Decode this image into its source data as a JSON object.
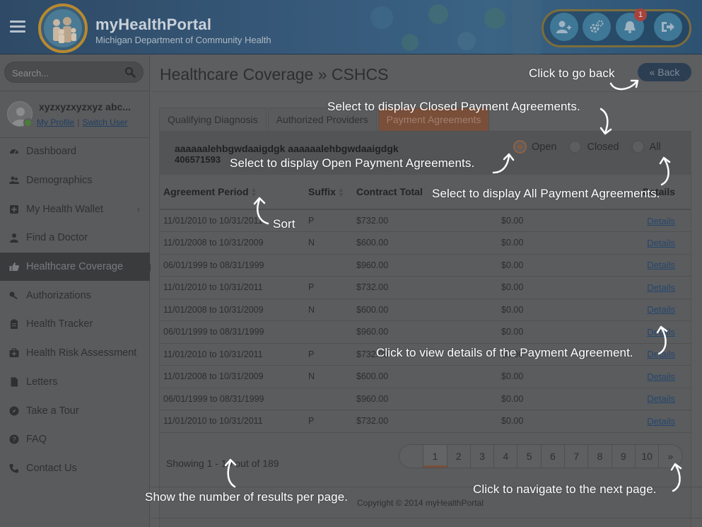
{
  "header": {
    "app_name": "myHealthPortal",
    "app_subtitle": "Michigan Department of Community Health",
    "notification_count": "1"
  },
  "sidebar": {
    "search_placeholder": "Search...",
    "user_name": "xyzxyzxyzxyz abc...",
    "my_profile": "My Profile",
    "switch_user": "Switch User",
    "items": [
      {
        "label": "Dashboard",
        "icon": "dashboard-icon"
      },
      {
        "label": "Demographics",
        "icon": "users-icon"
      },
      {
        "label": "My Health Wallet",
        "icon": "plus-square-icon"
      },
      {
        "label": "Find a Doctor",
        "icon": "user-md-icon"
      },
      {
        "label": "Healthcare Coverage",
        "icon": "thumbs-up-icon"
      },
      {
        "label": "Authorizations",
        "icon": "key-icon"
      },
      {
        "label": "Health Tracker",
        "icon": "clipboard-icon"
      },
      {
        "label": "Health Risk Assessment",
        "icon": "medkit-icon"
      },
      {
        "label": "Letters",
        "icon": "file-icon"
      },
      {
        "label": "Take a Tour",
        "icon": "compass-icon"
      },
      {
        "label": "FAQ",
        "icon": "question-icon"
      },
      {
        "label": "Contact Us",
        "icon": "phone-icon"
      }
    ]
  },
  "main": {
    "page_title": "Healthcare Coverage » CSHCS",
    "back_label": "« Back",
    "tabs": [
      "Qualifying Diagnosis",
      "Authorized Providers",
      "Payment Agreements"
    ],
    "member_name": "aaaaaalehbgwdaaigdgk aaaaaalehbgwdaaigdgk",
    "member_id": "406571593",
    "filters": [
      "Open",
      "Closed",
      "All"
    ],
    "columns": [
      "Agreement Period",
      "Suffix",
      "Contract Total",
      "",
      "Details"
    ],
    "rows": [
      {
        "period": "11/01/2010 to 10/31/2011",
        "suffix": "P",
        "total": "$732.00",
        "balance": "$0.00",
        "details": "Details"
      },
      {
        "period": "11/01/2008 to 10/31/2009",
        "suffix": "N",
        "total": "$600.00",
        "balance": "$0.00",
        "details": "Details"
      },
      {
        "period": "06/01/1999 to 08/31/1999",
        "suffix": "",
        "total": "$960.00",
        "balance": "$0.00",
        "details": "Details"
      },
      {
        "period": "11/01/2010 to 10/31/2011",
        "suffix": "P",
        "total": "$732.00",
        "balance": "$0.00",
        "details": "Details"
      },
      {
        "period": "11/01/2008 to 10/31/2009",
        "suffix": "N",
        "total": "$600.00",
        "balance": "$0.00",
        "details": "Details"
      },
      {
        "period": "06/01/1999 to 08/31/1999",
        "suffix": "",
        "total": "$960.00",
        "balance": "$0.00",
        "details": "Details"
      },
      {
        "period": "11/01/2010 to 10/31/2011",
        "suffix": "P",
        "total": "$732.00",
        "balance": "$0.00",
        "details": "Details"
      },
      {
        "period": "11/01/2008 to 10/31/2009",
        "suffix": "N",
        "total": "$600.00",
        "balance": "$0.00",
        "details": "Details"
      },
      {
        "period": "06/01/1999 to 08/31/1999",
        "suffix": "",
        "total": "$960.00",
        "balance": "$0.00",
        "details": "Details"
      },
      {
        "period": "11/01/2010 to 10/31/2011",
        "suffix": "P",
        "total": "$732.00",
        "balance": "$0.00",
        "details": "Details"
      }
    ],
    "showing": "Showing 1 - 10 out of 189",
    "pages": [
      "1",
      "2",
      "3",
      "4",
      "5",
      "6",
      "7",
      "8",
      "9",
      "10"
    ],
    "next_label": "»",
    "copyright": "Copyright © 2014 myHealthPortal"
  },
  "annotations": {
    "go_back": "Click to go back",
    "closed": "Select to display Closed Payment Agreements.",
    "open": "Select to display Open Payment Agreements.",
    "all": "Select to display All Payment Agreements.",
    "sort": "Sort",
    "details": "Click to view details of the Payment Agreement.",
    "per_page": "Show the number of results per page.",
    "next_page": "Click to navigate to the next page."
  },
  "colors": {
    "accent": "#7a4f3a",
    "header": "#37597a",
    "link": "#25476d"
  }
}
